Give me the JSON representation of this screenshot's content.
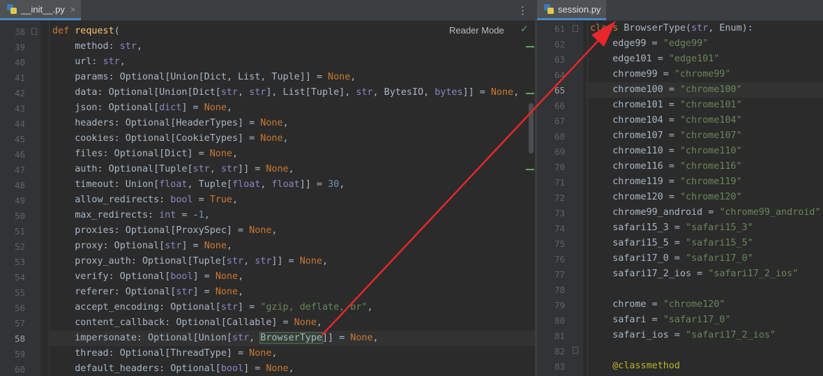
{
  "left_tab": {
    "label": "__init__.py",
    "close": "×"
  },
  "right_tab": {
    "label": "session.py"
  },
  "menu_label": "⋮",
  "reader_mode": "Reader Mode",
  "check": "✓",
  "left_lines": [
    {
      "n": "38",
      "h": "<span class='kw'>def</span> <span class='fn'>request</span>("
    },
    {
      "n": "39",
      "h": "    method: <span class='bi'>str</span>,"
    },
    {
      "n": "40",
      "h": "    url: <span class='bi'>str</span>,"
    },
    {
      "n": "41",
      "h": "    params: Optional[Union[Dict, List, Tuple]] = <span class='kw'>None</span>,"
    },
    {
      "n": "42",
      "h": "    data: Optional[Union[Dict[<span class='bi'>str</span>, <span class='bi'>str</span>], List[Tuple], <span class='bi'>str</span>, BytesIO, <span class='bi'>bytes</span>]] = <span class='kw'>None</span>,"
    },
    {
      "n": "43",
      "h": "    json: Optional[<span class='bi'>dict</span>] = <span class='kw'>None</span>,"
    },
    {
      "n": "44",
      "h": "    headers: Optional[HeaderTypes] = <span class='kw'>None</span>,"
    },
    {
      "n": "45",
      "h": "    cookies: Optional[CookieTypes] = <span class='kw'>None</span>,"
    },
    {
      "n": "46",
      "h": "    files: Optional[Dict] = <span class='kw'>None</span>,"
    },
    {
      "n": "47",
      "h": "    auth: Optional[Tuple[<span class='bi'>str</span>, <span class='bi'>str</span>]] = <span class='kw'>None</span>,"
    },
    {
      "n": "48",
      "h": "    timeout: Union[<span class='bi'>float</span>, Tuple[<span class='bi'>float</span>, <span class='bi'>float</span>]] = <span class='num'>30</span>,"
    },
    {
      "n": "49",
      "h": "    allow_redirects: <span class='bi'>bool</span> = <span class='kw'>True</span>,"
    },
    {
      "n": "50",
      "h": "    max_redirects: <span class='bi'>int</span> = -<span class='num'>1</span>,"
    },
    {
      "n": "51",
      "h": "    proxies: Optional[ProxySpec] = <span class='kw'>None</span>,"
    },
    {
      "n": "52",
      "h": "    proxy: Optional[<span class='bi'>str</span>] = <span class='kw'>None</span>,"
    },
    {
      "n": "53",
      "h": "    proxy_auth: Optional[Tuple[<span class='bi'>str</span>, <span class='bi'>str</span>]] = <span class='kw'>None</span>,"
    },
    {
      "n": "54",
      "h": "    verify: Optional[<span class='bi'>bool</span>] = <span class='kw'>None</span>,"
    },
    {
      "n": "55",
      "h": "    referer: Optional[<span class='bi'>str</span>] = <span class='kw'>None</span>,"
    },
    {
      "n": "56",
      "h": "    accept_encoding: Optional[<span class='bi'>str</span>] = <span class='str'>\"gzip, deflate, br\"</span>,"
    },
    {
      "n": "57",
      "h": "    content_callback: Optional[Callable] = <span class='kw'>None</span>,"
    },
    {
      "n": "58",
      "h": "    impersonate: Optional[Union[<span class='bi'>str</span>, <span class='hl'>BrowserType</span>]] = <span class='kw'>None</span>,",
      "cur": true
    },
    {
      "n": "59",
      "h": "    thread: Optional[ThreadType] = <span class='kw'>None</span>,"
    },
    {
      "n": "60",
      "h": "    default_headers: Optional[<span class='bi'>bool</span>] = <span class='kw'>None</span>,"
    }
  ],
  "right_lines": [
    {
      "n": "61",
      "h": "<span class='kw'>class</span> BrowserType(<span class='bi'>str</span>, Enum):"
    },
    {
      "n": "62",
      "h": "    edge99 = <span class='str'>\"edge99\"</span>"
    },
    {
      "n": "63",
      "h": "    edge101 = <span class='str'>\"edge101\"</span>"
    },
    {
      "n": "64",
      "h": "    chrome99 = <span class='str'>\"chrome99\"</span>"
    },
    {
      "n": "65",
      "h": "    chrome100 = <span class='str'>\"chrome100\"</span>",
      "cur": true
    },
    {
      "n": "66",
      "h": "    chrome101 = <span class='str'>\"chrome101\"</span>"
    },
    {
      "n": "67",
      "h": "    chrome104 = <span class='str'>\"chrome104\"</span>"
    },
    {
      "n": "68",
      "h": "    chrome107 = <span class='str'>\"chrome107\"</span>"
    },
    {
      "n": "69",
      "h": "    chrome110 = <span class='str'>\"chrome110\"</span>"
    },
    {
      "n": "70",
      "h": "    chrome116 = <span class='str'>\"chrome116\"</span>"
    },
    {
      "n": "71",
      "h": "    chrome119 = <span class='str'>\"chrome119\"</span>"
    },
    {
      "n": "72",
      "h": "    chrome120 = <span class='str'>\"chrome120\"</span>"
    },
    {
      "n": "73",
      "h": "    chrome99_android = <span class='str'>\"chrome99_android\"</span>"
    },
    {
      "n": "74",
      "h": "    safari15_3 = <span class='str'>\"safari15_3\"</span>"
    },
    {
      "n": "75",
      "h": "    safari15_5 = <span class='str'>\"safari15_5\"</span>"
    },
    {
      "n": "76",
      "h": "    safari17_0 = <span class='str'>\"safari17_0\"</span>"
    },
    {
      "n": "77",
      "h": "    safari17_2_ios = <span class='str'>\"safari17_2_ios\"</span>"
    },
    {
      "n": "78",
      "h": ""
    },
    {
      "n": "79",
      "h": "    chrome = <span class='str'>\"chrome120\"</span>"
    },
    {
      "n": "80",
      "h": "    safari = <span class='str'>\"safari17_0\"</span>"
    },
    {
      "n": "81",
      "h": "    safari_ios = <span class='str'>\"safari17_2_ios\"</span>"
    },
    {
      "n": "82",
      "h": ""
    },
    {
      "n": "83",
      "h": "    <span class='deco'>@classmethod</span>"
    }
  ],
  "colors": {
    "arrow": "#e8262b",
    "keyword": "#cc7832",
    "string": "#6a8759",
    "builtin": "#8888c6",
    "function": "#ffc66d"
  }
}
